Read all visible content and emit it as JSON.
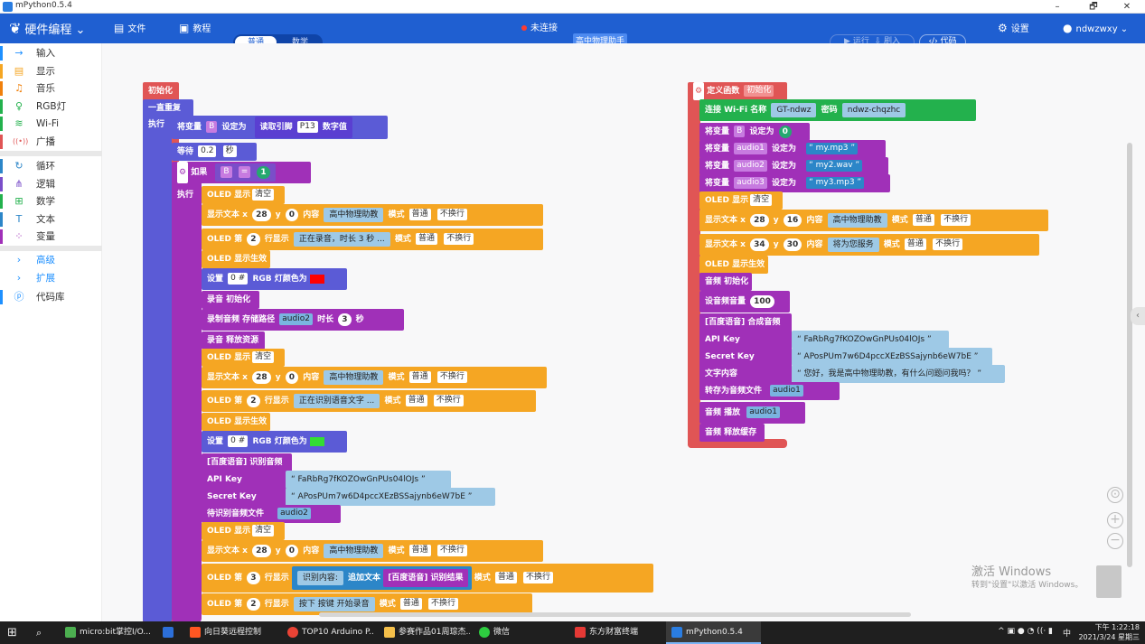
{
  "window": {
    "title": "mPython0.5.4",
    "controls": [
      "–",
      "🗗",
      "✕"
    ]
  },
  "menubar": {
    "brand": "硬件编程",
    "file": "文件",
    "tutorial": "教程",
    "mode_normal": "普通",
    "mode_math": "数学",
    "connection": "未连接",
    "assistant": "高中物理助手",
    "run": "运行",
    "flash": "刷入",
    "code": "代码",
    "settings": "设置",
    "user": "ndwzwxy"
  },
  "sidebar": {
    "items": [
      {
        "label": "输入",
        "color": "#1e90ff",
        "icon": "→"
      },
      {
        "label": "显示",
        "color": "#f5a623",
        "icon": "▤"
      },
      {
        "label": "音乐",
        "color": "#f0800c",
        "icon": "♫"
      },
      {
        "label": "RGB灯",
        "color": "#23b14d",
        "icon": "♀"
      },
      {
        "label": "Wi-Fi",
        "color": "#23b14d",
        "icon": "≋"
      },
      {
        "label": "广播",
        "color": "#e05555",
        "icon": "((•))"
      },
      {
        "label": "循环",
        "color": "#2c86c8",
        "icon": "↻"
      },
      {
        "label": "逻辑",
        "color": "#7a4ec9",
        "icon": "⋔"
      },
      {
        "label": "数学",
        "color": "#23b14d",
        "icon": "⊞"
      },
      {
        "label": "文本",
        "color": "#2c86c8",
        "icon": "T"
      },
      {
        "label": "变量",
        "color": "#a030b8",
        "icon": "⁘"
      },
      {
        "label": "高级",
        "color": "#1e90ff",
        "icon": "›"
      },
      {
        "label": "扩展",
        "color": "#1e90ff",
        "icon": "›"
      },
      {
        "label": "代码库",
        "color": "#1e90ff",
        "icon": "ⓟ"
      }
    ]
  },
  "left_program": {
    "init": "初始化",
    "repeat": "一直重复",
    "exec": "执行",
    "set_var": "将变量",
    "var_B": "B",
    "set_to": "设定为",
    "read_pin": "读取引脚",
    "pin": "P13",
    "digital": "数字值",
    "wait": "等待",
    "wait_val": "0.2",
    "sec_unit": "秒",
    "if": "如果",
    "eq": "=",
    "one": "1",
    "oled_clear": "OLED 显示",
    "clear": "清空",
    "show_text": "显示文本 x",
    "x28": "28",
    "y": "y",
    "y0": "0",
    "content": "内容",
    "title_text": "高中物理助教",
    "mode": "模式",
    "normal": "普通",
    "nowrap": "不换行",
    "oled_line": "OLED 第",
    "line2": "2",
    "line_show": "行显示",
    "recording_text": "正在录音，时长 3 秒 ...",
    "oled_effect": "OLED 显示生效",
    "set": "设置",
    "rgb_all": "0 #",
    "rgb_color": "RGB 灯颜色为",
    "rec_init": "录音 初始化",
    "rec_audio": "录制音频 存储路径",
    "audio2": "audio2",
    "duration": "时长",
    "dur_val": "3",
    "sec": "秒",
    "rec_release": "录音 释放资源",
    "recognizing_text": "正在识别语音文字 ...",
    "baidu_recognize": "[百度语音] 识别音频",
    "api_key": "API Key",
    "api_val": "FaRbRg7fKOZOwGnPUs04lOJs",
    "secret_key": "Secret Key",
    "secret_val": "APosPUm7w6D4pccXEzBSSajynb6eW7bE",
    "recognize_file": "待识别音频文件",
    "line3": "3",
    "recognized_prefix": "识别内容:",
    "append_text": "追加文本",
    "recognize_result": "[百度语音] 识别结果",
    "press_text": "按下 按键 开始录音"
  },
  "right_program": {
    "define": "定义函数",
    "fn_name": "初始化",
    "wifi": "连接 Wi-Fi 名称",
    "ssid": "GT-ndwz",
    "pwd_label": "密码",
    "pwd": "ndwz-chqzhc",
    "set_var": "将变量",
    "var_B": "B",
    "set_to": "设定为",
    "zero": "0",
    "audio1": "audio1",
    "audio2": "audio2",
    "audio3": "audio3",
    "mp3a": "my.mp3",
    "wav": "my2.wav",
    "mp3b": "my3.mp3",
    "oled_clear": "OLED 显示",
    "clear": "清空",
    "show_text": "显示文本 x",
    "x28": "28",
    "y": "y",
    "y16": "16",
    "content": "内容",
    "title_text": "高中物理助教",
    "mode": "模式",
    "normal": "普通",
    "nowrap": "不换行",
    "x34": "34",
    "y30": "30",
    "serve_text": "将为您服务",
    "oled_effect": "OLED 显示生效",
    "audio_init": "音频 初始化",
    "volume": "设音频音量",
    "vol_val": "100",
    "baidu_tts": "[百度语音] 合成音频",
    "api_key": "API Key",
    "api_val": "FaRbRg7fKOZOwGnPUs04lOJs",
    "secret_key": "Secret Key",
    "secret_val": "APosPUm7w6D4pccXEzBSSajynb6eW7bE",
    "text_content": "文字内容",
    "greeting": "您好，我是高中物理助教，有什么问题问我吗？",
    "save_as": "转存为音频文件",
    "play": "音频 播放",
    "release": "音频 释放缓存"
  },
  "watermark": {
    "line1": "激活 Windows",
    "line2": "转到\"设置\"以激活 Windows。"
  },
  "taskbar": {
    "items": [
      {
        "label": "micro:bit掌控I/O...",
        "color": "#4caf50"
      },
      {
        "label": "",
        "color": "#2c6fd9"
      },
      {
        "label": "向日葵远程控制",
        "color": "#ff5722"
      },
      {
        "label": "TOP10 Arduino P...",
        "color": "#ea4335"
      },
      {
        "label": "参赛作品01周琮杰...",
        "color": "#f5c04a"
      },
      {
        "label": "微信",
        "color": "#2ecc40"
      },
      {
        "label": "东方财富终端",
        "color": "#e53935"
      },
      {
        "label": "mPython0.5.4",
        "color": "#2a7de1"
      }
    ],
    "time": "下午 1:22:18",
    "date": "2021/3/24 星期三",
    "ime": "中"
  }
}
